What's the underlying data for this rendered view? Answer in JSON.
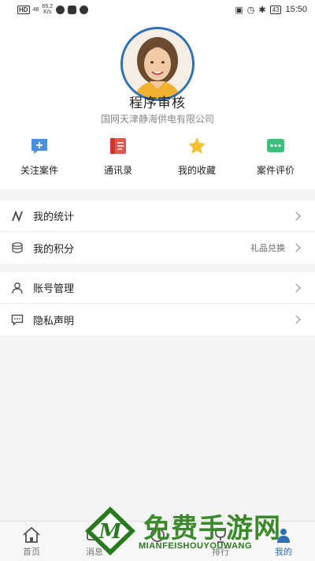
{
  "status_bar": {
    "hd": "HD",
    "signal": "46",
    "speed_value": "65.2",
    "speed_unit": "K/s",
    "battery": "43",
    "time": "15:50"
  },
  "profile": {
    "name": "程序审核",
    "company": "国网天津静海供电有限公司"
  },
  "quick_actions": [
    {
      "label": "关注案件",
      "icon": "follow-case-icon",
      "color": "#4a8fe0"
    },
    {
      "label": "通讯录",
      "icon": "contacts-icon",
      "color": "#e8554a"
    },
    {
      "label": "我的收藏",
      "icon": "star-icon",
      "color": "#f5c030"
    },
    {
      "label": "案件评价",
      "icon": "chat-bubble-icon",
      "color": "#3bbf7a"
    }
  ],
  "menu": {
    "group1": [
      {
        "label": "我的统计",
        "icon": "stats-icon",
        "extra": ""
      },
      {
        "label": "我的积分",
        "icon": "coins-icon",
        "extra": "礼品兑换"
      }
    ],
    "group2": [
      {
        "label": "账号管理",
        "icon": "user-icon",
        "extra": ""
      },
      {
        "label": "隐私声明",
        "icon": "message-icon",
        "extra": ""
      }
    ]
  },
  "bottom_nav": [
    {
      "label": "首页",
      "icon": "home-icon",
      "active": false
    },
    {
      "label": "消息",
      "icon": "message-nav-icon",
      "active": false
    },
    {
      "label": "",
      "icon": "center-icon",
      "active": false
    },
    {
      "label": "排行",
      "icon": "trophy-icon",
      "active": false
    },
    {
      "label": "我的",
      "icon": "profile-nav-icon",
      "active": true
    }
  ],
  "watermark": {
    "text": "免费手游网",
    "sub": "MIANFEISHOUYOUWANG"
  },
  "colors": {
    "accent": "#2f6fb3",
    "background": "#f4f4f4"
  }
}
